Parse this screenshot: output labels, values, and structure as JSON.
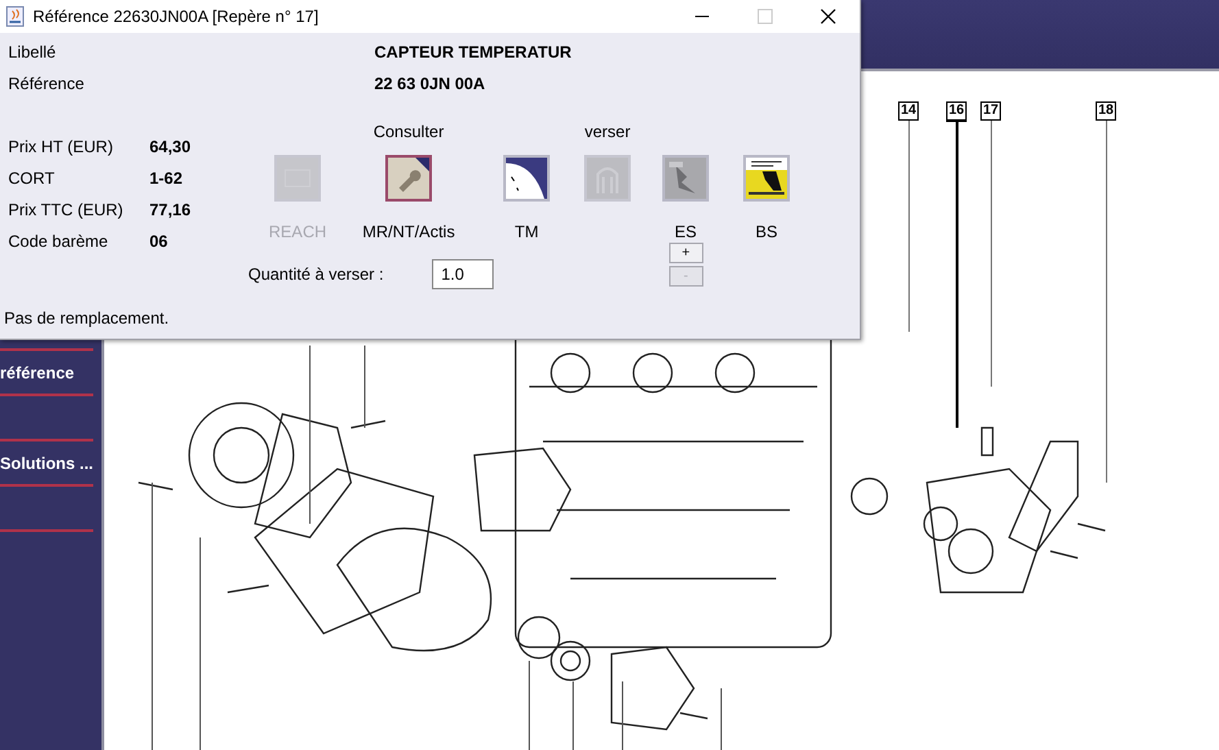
{
  "window": {
    "title": "Référence 22630JN00A [Repère n° 17]"
  },
  "fields": [
    {
      "label": "Libellé",
      "value": "CAPTEUR TEMPERATUR"
    },
    {
      "label": "Référence",
      "value": "22 63 0JN 00A"
    }
  ],
  "prices": [
    {
      "label": "Prix HT (EUR)",
      "value": "64,30"
    },
    {
      "label": "CORT",
      "value": "1-62"
    },
    {
      "label": "Prix TTC (EUR)",
      "value": "77,16"
    },
    {
      "label": "Code barème",
      "value": "06"
    }
  ],
  "actions": {
    "headings": [
      "Consulter",
      "verser"
    ],
    "buttons": [
      {
        "kind": "reach",
        "label": "REACH",
        "disabled": true,
        "selected": false
      },
      {
        "kind": "wrench",
        "label": "MR/NT/Actis",
        "disabled": false,
        "selected": true
      },
      {
        "kind": "tm",
        "label": "TM",
        "disabled": false,
        "selected": false
      },
      {
        "kind": "arch",
        "disabled": true,
        "selected": false
      },
      {
        "kind": "es",
        "label": "ES",
        "disabled": false,
        "selected": false
      },
      {
        "kind": "bs",
        "label": "BS",
        "disabled": false,
        "selected": false
      }
    ]
  },
  "quantity": {
    "label": "Quantité à verser :",
    "value": "1.0",
    "steppers": [
      {
        "label": "+",
        "disabled": false
      },
      {
        "label": "-",
        "disabled": true
      }
    ]
  },
  "message": "Pas de remplacement.",
  "background": {
    "sidebar": {
      "items": [
        {
          "label": "référence"
        },
        {
          "label": "Solutions ..."
        }
      ]
    },
    "callouts": [
      {
        "label": "14",
        "selected": false
      },
      {
        "label": "16",
        "selected": true
      },
      {
        "label": "17",
        "selected": false
      },
      {
        "label": "18",
        "selected": false
      }
    ]
  }
}
